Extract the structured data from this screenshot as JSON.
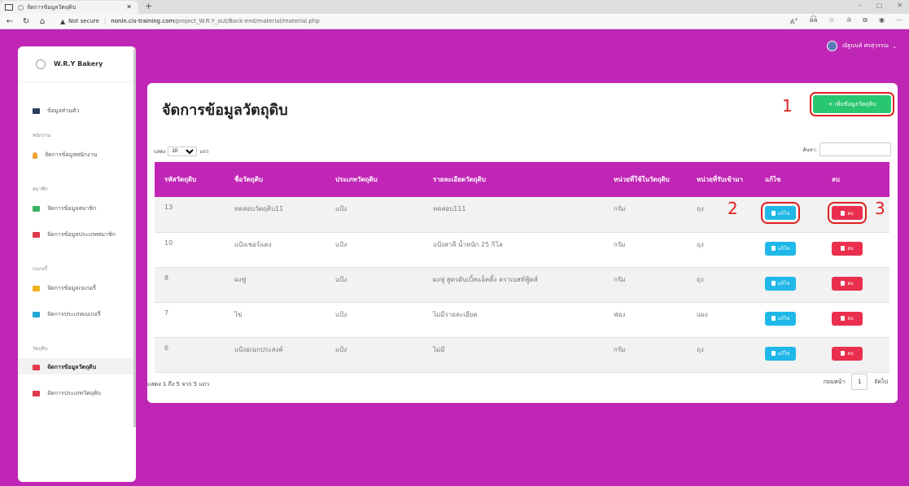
{
  "browser": {
    "tab_title": "จัดการข้อมูลวัตถุดิบ",
    "new_tab": "+",
    "not_secure": "Not secure",
    "url_domain": "nonin.cis-training.com",
    "url_path": "/project_W.R.Y_out/Back-end/material/material.php",
    "window_controls": [
      "–",
      "▢",
      "✕"
    ],
    "toolbar_icons": [
      "read-aloud-icon",
      "translate-icon",
      "favorite-add-icon",
      "favorites-icon",
      "collections-icon",
      "profile-icon",
      "more-icon"
    ]
  },
  "sidebar": {
    "brand": "W.R.Y Bakery",
    "profile_item": "ข้อมูลส่วนตัว",
    "sections": [
      {
        "label": "พนักงาน",
        "items": [
          "จัดการข้อมูลพนักงาน"
        ]
      },
      {
        "label": "สมาชิก",
        "items": [
          "จัดการข้อมูลสมาชิก",
          "จัดการข้อมูลประเภทสมาชิก"
        ]
      },
      {
        "label": "เบเกอรี่",
        "items": [
          "จัดการข้อมูลเบเกอรี่",
          "จัดการประเภทเบเกอรี่"
        ]
      },
      {
        "label": "วัตถุดิบ",
        "items": [
          "จัดการข้อมูลวัตถุดิบ",
          "จัดการประเภทวัตถุดิบ"
        ]
      }
    ]
  },
  "user": {
    "name": "ณัฐนนท์ ศรสุวรรณ",
    "chevron": "⌄"
  },
  "main": {
    "title": "จัดการข้อมูลวัตถุดิบ",
    "add_button": "+ เพิ่มข้อมูลวัตถุดิบ",
    "show_prefix": "แสดง",
    "page_length": "10",
    "show_suffix": "แถว",
    "search_label": "ค้นหา:",
    "columns": [
      "รหัสวัตถุดิบ",
      "ชื่อวัตถุดิบ",
      "ประเภทวัตถุดิบ",
      "รายละเอียดวัตถุดิบ",
      "หน่วยที่ใช้ในวัตถุดิบ",
      "หน่วยที่รับเข้ามา",
      "แก้ไข",
      "ลบ"
    ],
    "rows": [
      {
        "id": "13",
        "name": "ทดสอบวัตถุดิบ11",
        "type": "แป้ง",
        "detail": "ทดสอบ111",
        "use_unit": "กรัม",
        "recv_unit": "ถุง"
      },
      {
        "id": "10",
        "name": "แป้งเชอร์แดง",
        "type": "แป้ง",
        "detail": "แป้งสาลี น้ำหนัก 25 กิโล",
        "use_unit": "กรัม",
        "recv_unit": "ถุง"
      },
      {
        "id": "8",
        "name": "ผงฟู",
        "type": "แป้ง",
        "detail": "ผงฟู สูตรดับเบิ้ลแอ็คติ้ง ตราเบสท์ฟู้ดส์",
        "use_unit": "กรัม",
        "recv_unit": "ถุง"
      },
      {
        "id": "7",
        "name": "ไข่",
        "type": "แป้ง",
        "detail": "ไม่มีรายละเอียด",
        "use_unit": "ฟอง",
        "recv_unit": "แผง"
      },
      {
        "id": "6",
        "name": "แป้งอเนกประสงค์",
        "type": "แป้ง",
        "detail": "ไม่มี",
        "use_unit": "กรัม",
        "recv_unit": "ถุง"
      }
    ],
    "edit_label": "แก้ไข",
    "delete_label": "ลบ",
    "info": "แสดง 1 ถึง 5 จาก 5 แถว",
    "prev": "ก่อนหน้า",
    "page": "1",
    "next": "ถัดไป"
  },
  "annotations": [
    "1",
    "2",
    "3"
  ],
  "colors": {
    "accent": "#c026b5",
    "add": "#28c76f",
    "edit": "#1fb8e8",
    "delete": "#ea2f4e",
    "annotation": "#e02020"
  }
}
